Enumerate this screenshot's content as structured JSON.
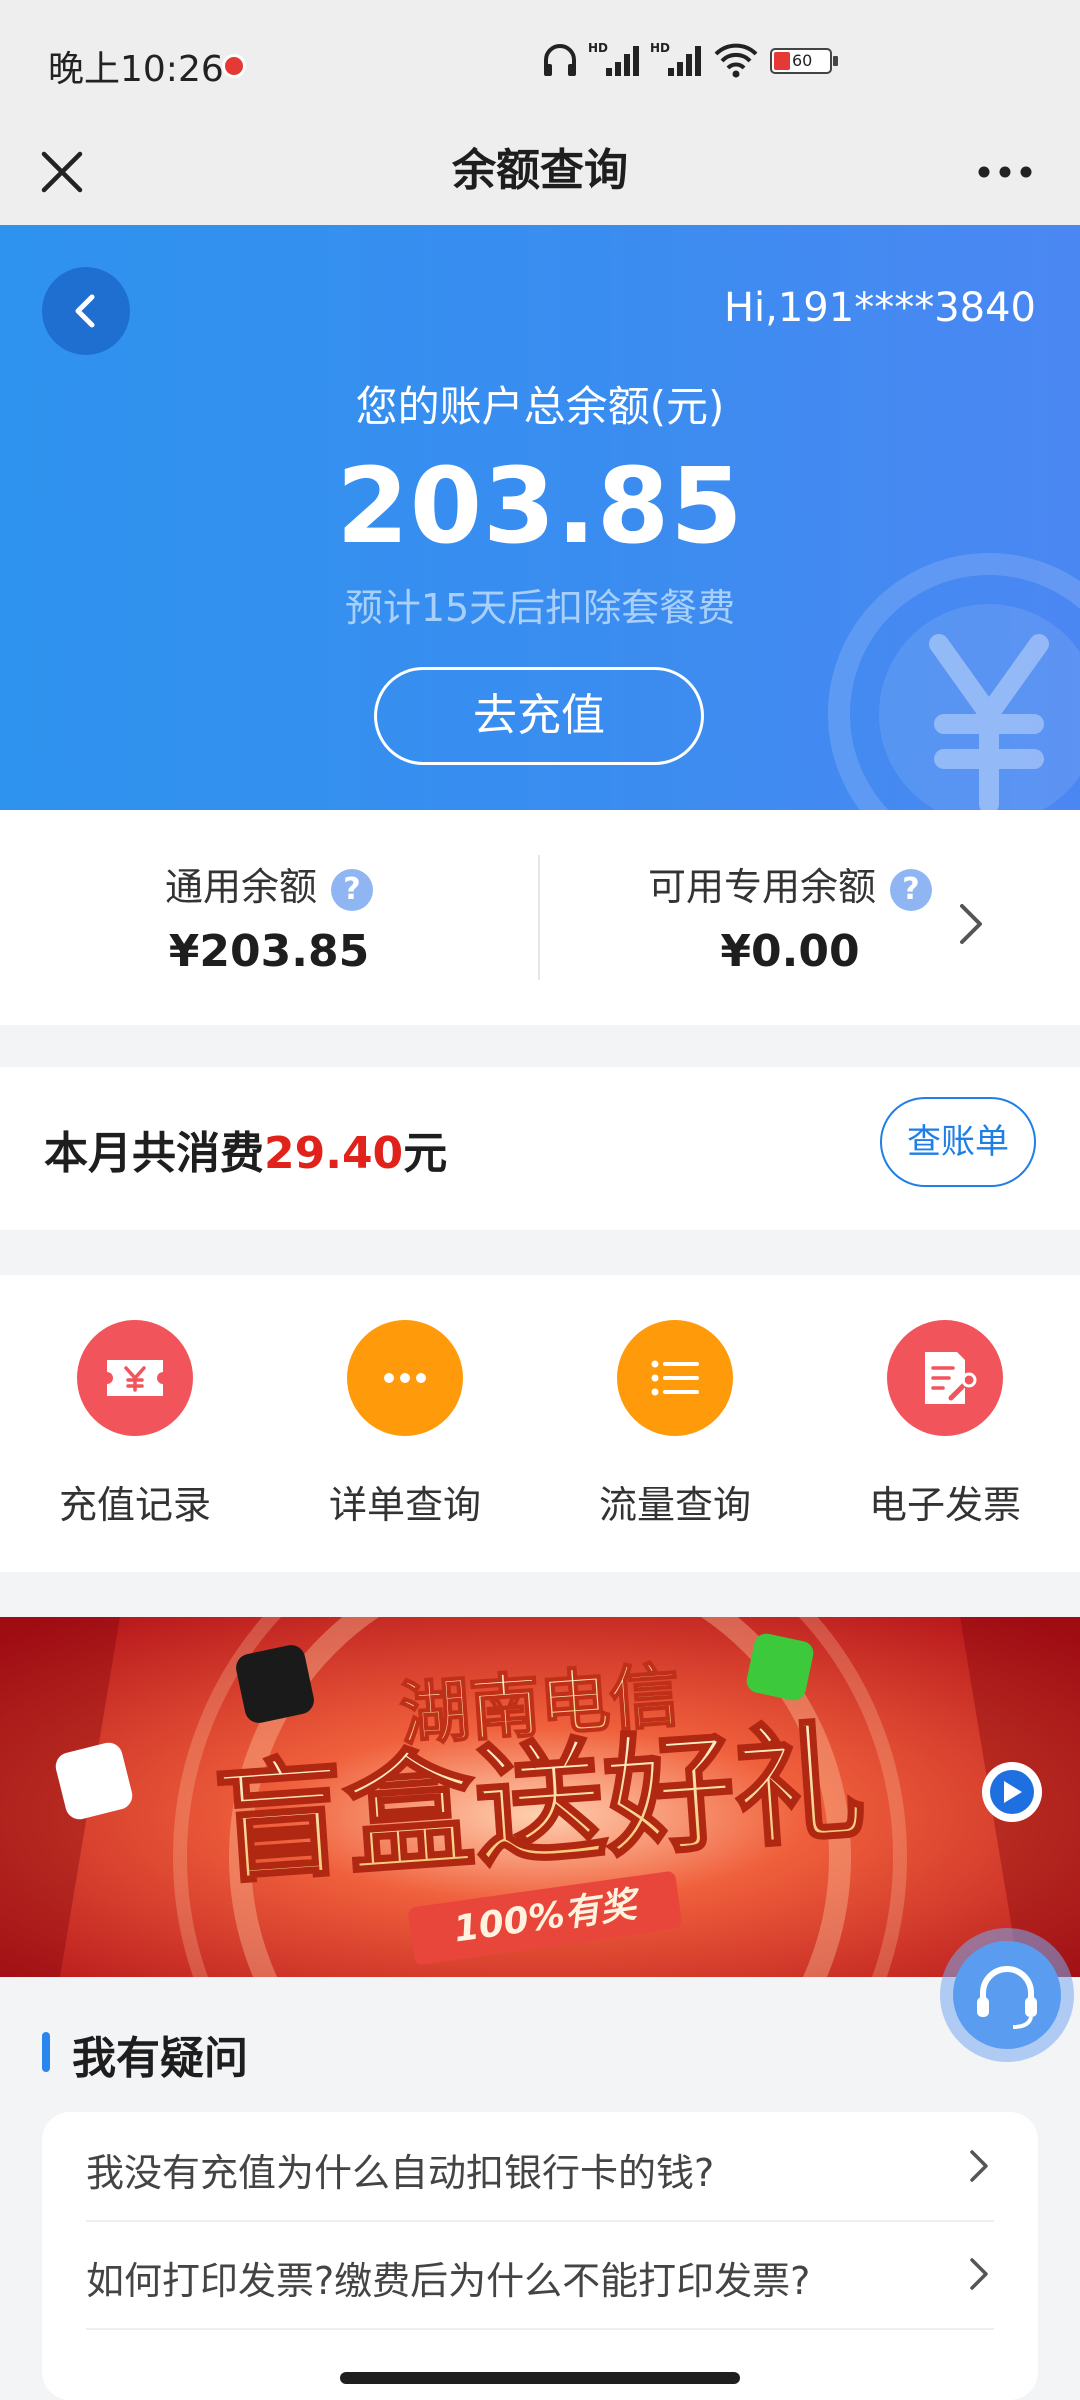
{
  "status_bar": {
    "time": "晚上10:26",
    "battery": "60"
  },
  "title_bar": {
    "title": "余额查询"
  },
  "hero": {
    "greeting": "Hi,191****3840",
    "balance_label": "您的账户总余额(元)",
    "balance_value": "203.85",
    "note": "预计15天后扣除套餐费",
    "recharge_label": "去充值"
  },
  "balances": {
    "general": {
      "label": "通用余额",
      "value": "¥203.85"
    },
    "special": {
      "label": "可用专用余额",
      "value": "¥0.00"
    },
    "help_glyph": "?"
  },
  "month": {
    "prefix": "本月共消费",
    "amount": "29.40",
    "unit": "元",
    "bill_label": "查账单"
  },
  "actions": [
    {
      "label": "充值记录",
      "icon": "recharge-record-icon",
      "color": "#f2545b"
    },
    {
      "label": "详单查询",
      "icon": "more-dots-icon",
      "color": "#ff9a0a"
    },
    {
      "label": "流量查询",
      "icon": "list-icon",
      "color": "#ff9a0a"
    },
    {
      "label": "电子发票",
      "icon": "invoice-icon",
      "color": "#f2545b"
    }
  ],
  "banner": {
    "title": "湖南电信",
    "headline": "盲盒送好礼",
    "tag": "100%有奖"
  },
  "faq": {
    "title": "我有疑问",
    "items": [
      "我没有充值为什么自动扣银行卡的钱?",
      "如何打印发票?缴费后为什么不能打印发票?"
    ]
  }
}
